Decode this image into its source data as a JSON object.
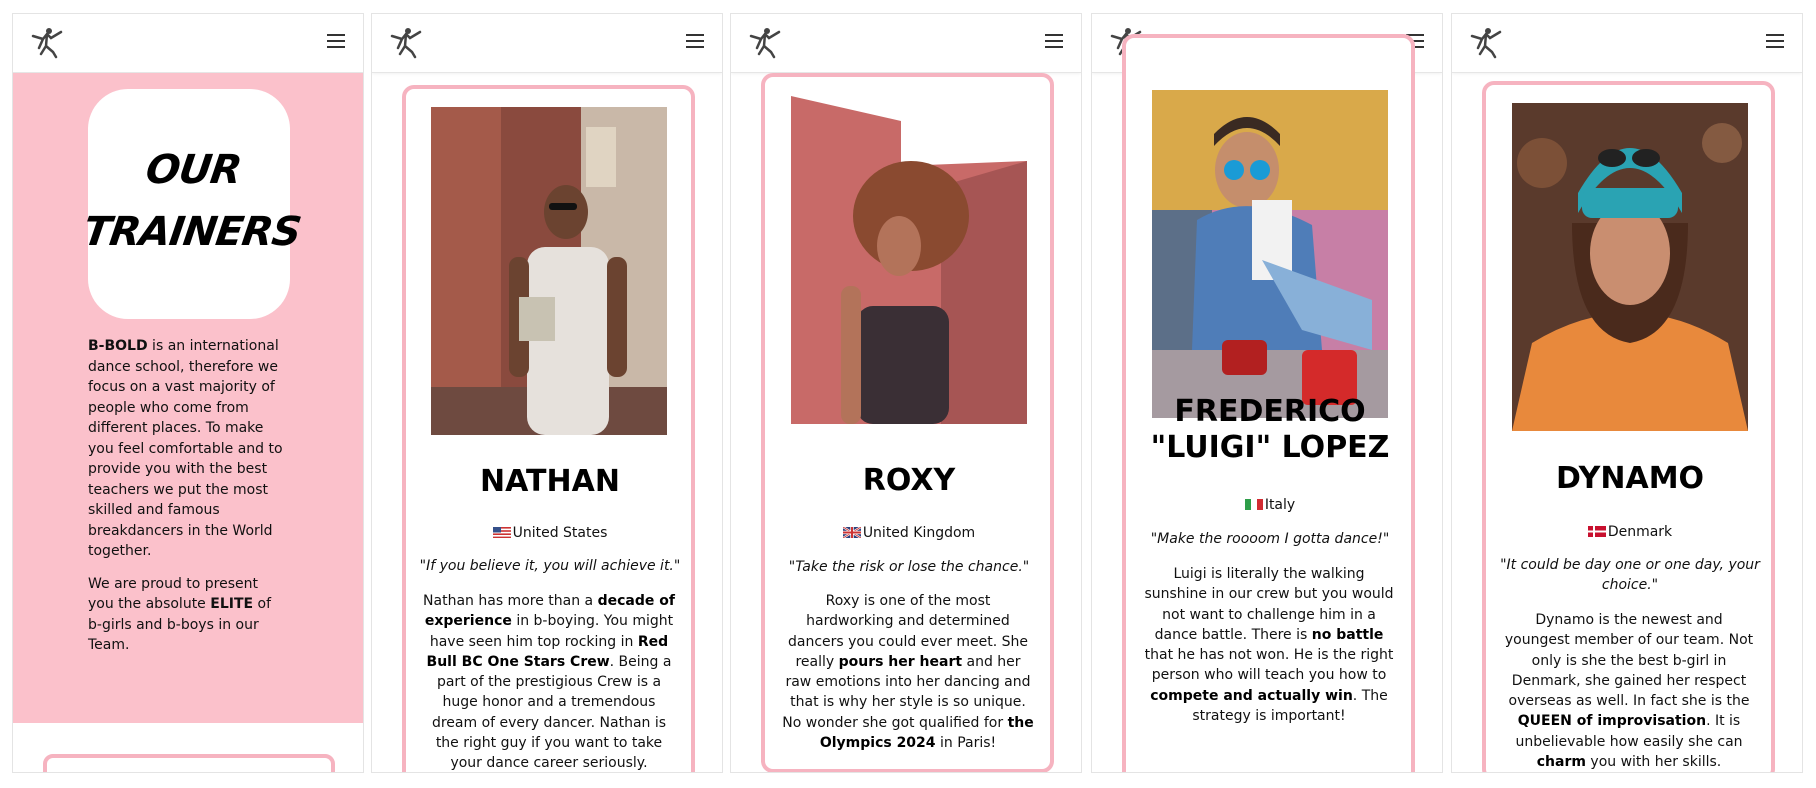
{
  "colors": {
    "pink": "#fbc1cb",
    "card_border": "#f6b3c0"
  },
  "header": {
    "logo_icon": "breakdancer-logo-icon",
    "menu_icon": "hamburger-menu-icon"
  },
  "intro": {
    "title_line1": "OUR",
    "title_line2": "TRAINERS",
    "p1_brand": "B-BOLD",
    "p1_rest": " is an international dance school, therefore we focus on a vast majority of people who come from different places. To make you feel comfortable and to provide you with the best teachers we put the most skilled and famous breakdancers in the World together.",
    "p2_a": "We are proud to present you the absolute ",
    "p2_b": "ELITE",
    "p2_c": " of b-girls and b-boys in our Team."
  },
  "trainers": [
    {
      "name": "NATHAN",
      "country": "United States",
      "quote": "\"If you believe it, you will achieve it.\"",
      "bio": [
        "Nathan has more than a ",
        "decade of experience",
        " in b-boying. You might have seen him top rocking in ",
        "Red Bull BC One Stars Crew",
        ". Being a part of the prestigious Crew is a huge honor and a tremendous dream of every dancer. Nathan is the right guy if you want to take your dance career seriously."
      ]
    },
    {
      "name": "ROXY",
      "country": "United Kingdom",
      "quote": "\"Take the risk or lose the chance.\"",
      "bio": [
        "Roxy is one of the most hardworking and determined dancers you could ever meet. She really ",
        "pours her heart",
        " and her raw emotions into her dancing and that is why her style is so unique. No wonder she got qualified for ",
        "the Olympics 2024",
        " in Paris!"
      ]
    },
    {
      "name_line1": "FREDERICO",
      "name_line2": "\"LUIGI\" LOPEZ",
      "country": "Italy",
      "quote": "\"Make the roooom I gotta dance!\"",
      "bio": [
        "Luigi is literally the walking sunshine in our crew but you would not want to challenge him in a dance battle. There is ",
        "no battle",
        " that he has not won. He is the right person who will teach you how to ",
        "compete and actually win",
        ". The strategy is important!"
      ]
    },
    {
      "name": "DYNAMO",
      "country": "Denmark",
      "quote": "\"It could be day one or one day, your choice.\"",
      "bio": [
        "Dynamo is the newest and youngest member of our team. Not only is she the best b-girl in Denmark, she gained her respect overseas as well. In fact she is the ",
        "QUEEN of improvisation",
        ". It is unbelievable how easily she can ",
        "charm",
        " you with her skills."
      ]
    }
  ]
}
